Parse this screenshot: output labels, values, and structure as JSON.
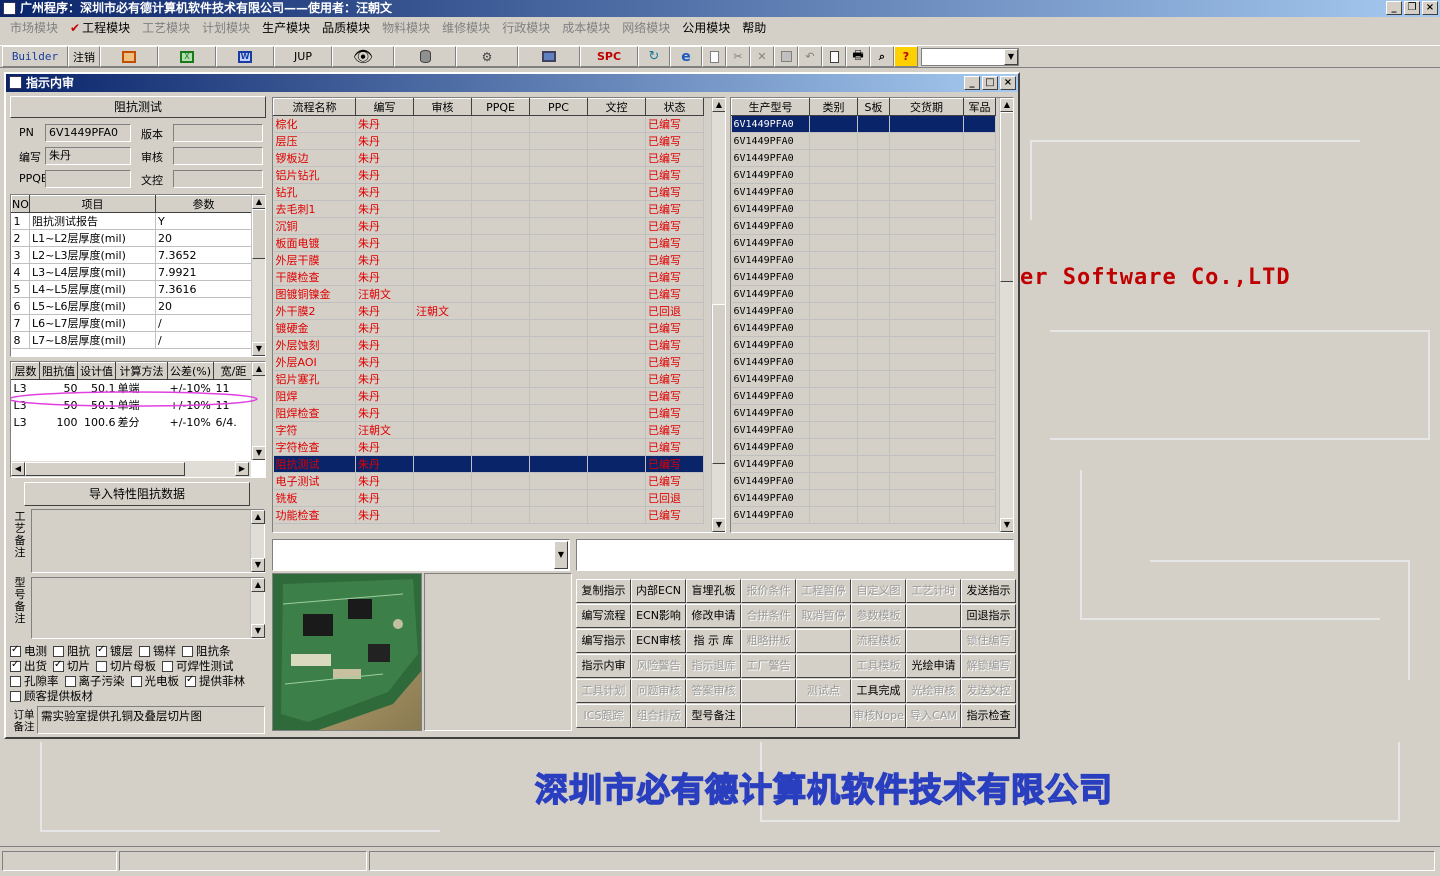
{
  "app": {
    "title": "广州程序：深圳市必有德计算机软件技术有限公司——使用者：汪朝文"
  },
  "menu": [
    {
      "label": "市场模块",
      "active": false
    },
    {
      "label": "工程模块",
      "active": true
    },
    {
      "label": "工艺模块",
      "active": false
    },
    {
      "label": "计划模块",
      "active": false
    },
    {
      "label": "生产模块",
      "active": true
    },
    {
      "label": "品质模块",
      "active": true
    },
    {
      "label": "物料模块",
      "active": false
    },
    {
      "label": "维修模块",
      "active": false
    },
    {
      "label": "行政模块",
      "active": false
    },
    {
      "label": "成本模块",
      "active": false
    },
    {
      "label": "网络模块",
      "active": false
    },
    {
      "label": "公用模块",
      "active": true
    },
    {
      "label": "帮助",
      "active": true
    }
  ],
  "toolbar": {
    "builder": "Builder",
    "logout": "注销",
    "jup": "JUP",
    "spc": "SPC",
    "question": "?"
  },
  "background": {
    "en_text": "er Software Co.,LTD",
    "cn_text": "深圳市必有德计算机软件技术有限公司"
  },
  "child": {
    "title": "指示内审"
  },
  "left": {
    "section_title": "阻抗测试",
    "pn_label": "PN",
    "pn_value": "6V1449PFA0",
    "version_label": "版本",
    "version_value": "",
    "author_label": "编写",
    "author_value": "朱丹",
    "review_label": "审核",
    "review_value": "",
    "ppqe_label": "PPQE",
    "ppqe_value": "",
    "doc_label": "文控",
    "doc_value": "",
    "params_headers": [
      "NO",
      "项目",
      "参数"
    ],
    "params": [
      [
        "1",
        "阻抗测试报告",
        "Y"
      ],
      [
        "2",
        "L1~L2层厚度(mil)",
        "20"
      ],
      [
        "3",
        "L2~L3层厚度(mil)",
        "7.3652"
      ],
      [
        "4",
        "L3~L4层厚度(mil)",
        "7.9921"
      ],
      [
        "5",
        "L4~L5层厚度(mil)",
        "7.3616"
      ],
      [
        "6",
        "L5~L6层厚度(mil)",
        "20"
      ],
      [
        "7",
        "L6~L7层厚度(mil)",
        "/"
      ],
      [
        "8",
        "L7~L8层厚度(mil)",
        "/"
      ]
    ],
    "imp_headers": [
      "层数",
      "阻抗值",
      "设计值",
      "计算方法",
      "公差(%)",
      "宽/距"
    ],
    "imp_rows": [
      [
        "L3",
        "50",
        "50.1",
        "单端",
        "+/-10%",
        "11"
      ],
      [
        "L3",
        "50",
        "50.1",
        "单端",
        "+/-10%",
        "11"
      ],
      [
        "L3",
        "100",
        "100.6",
        "差分",
        "+/-10%",
        "6/4."
      ]
    ],
    "import_btn": "导入特性阻抗数据",
    "process_note_label": "工艺备注",
    "model_note_label": "型号备注",
    "checkboxes": [
      [
        {
          "label": "电测",
          "on": true
        },
        {
          "label": "阻抗",
          "on": false
        },
        {
          "label": "镀层",
          "on": true
        },
        {
          "label": "锡样",
          "on": false
        },
        {
          "label": "阻抗条",
          "on": false
        }
      ],
      [
        {
          "label": "出货",
          "on": true
        },
        {
          "label": "切片",
          "on": true
        },
        {
          "label": "切片母板",
          "on": false
        },
        {
          "label": "可焊性测试",
          "on": false
        }
      ],
      [
        {
          "label": "孔隙率",
          "on": false
        },
        {
          "label": "离子污染",
          "on": false
        },
        {
          "label": "光电板",
          "on": false
        },
        {
          "label": "提供菲林",
          "on": true
        }
      ],
      [
        {
          "label": "顾客提供板材",
          "on": false
        }
      ]
    ],
    "order_note_label": "订单备注",
    "order_note_value": "需实验室提供孔铜及叠层切片图"
  },
  "process": {
    "headers": [
      "流程名称",
      "编写",
      "审核",
      "PPQE",
      "PPC",
      "文控",
      "状态"
    ],
    "rows": [
      [
        "棕化",
        "朱丹",
        "",
        "",
        "",
        "",
        "已编写"
      ],
      [
        "层压",
        "朱丹",
        "",
        "",
        "",
        "",
        "已编写"
      ],
      [
        "锣板边",
        "朱丹",
        "",
        "",
        "",
        "",
        "已编写"
      ],
      [
        "铝片钻孔",
        "朱丹",
        "",
        "",
        "",
        "",
        "已编写"
      ],
      [
        "钻孔",
        "朱丹",
        "",
        "",
        "",
        "",
        "已编写"
      ],
      [
        "去毛刺1",
        "朱丹",
        "",
        "",
        "",
        "",
        "已编写"
      ],
      [
        "沉铜",
        "朱丹",
        "",
        "",
        "",
        "",
        "已编写"
      ],
      [
        "板面电镀",
        "朱丹",
        "",
        "",
        "",
        "",
        "已编写"
      ],
      [
        "外层干膜",
        "朱丹",
        "",
        "",
        "",
        "",
        "已编写"
      ],
      [
        "干膜检查",
        "朱丹",
        "",
        "",
        "",
        "",
        "已编写"
      ],
      [
        "图镀铜镍金",
        "汪朝文",
        "",
        "",
        "",
        "",
        "已编写"
      ],
      [
        "外干膜2",
        "朱丹",
        "汪朝文",
        "",
        "",
        "",
        "已回退"
      ],
      [
        "镀硬金",
        "朱丹",
        "",
        "",
        "",
        "",
        "已编写"
      ],
      [
        "外层蚀刻",
        "朱丹",
        "",
        "",
        "",
        "",
        "已编写"
      ],
      [
        "外层AOI",
        "朱丹",
        "",
        "",
        "",
        "",
        "已编写"
      ],
      [
        "铝片塞孔",
        "朱丹",
        "",
        "",
        "",
        "",
        "已编写"
      ],
      [
        "阻焊",
        "朱丹",
        "",
        "",
        "",
        "",
        "已编写"
      ],
      [
        "阻焊检查",
        "朱丹",
        "",
        "",
        "",
        "",
        "已编写"
      ],
      [
        "字符",
        "汪朝文",
        "",
        "",
        "",
        "",
        "已编写"
      ],
      [
        "字符检查",
        "朱丹",
        "",
        "",
        "",
        "",
        "已编写"
      ],
      [
        "阻抗测试",
        "朱丹",
        "",
        "",
        "",
        "",
        "已编写"
      ],
      [
        "电子测试",
        "朱丹",
        "",
        "",
        "",
        "",
        "已编写"
      ],
      [
        "铣板",
        "朱丹",
        "",
        "",
        "",
        "",
        "已回退"
      ],
      [
        "功能检查",
        "朱丹",
        "",
        "",
        "",
        "",
        "已编写"
      ]
    ]
  },
  "models": {
    "headers": [
      "生产型号",
      "类别",
      "S板",
      "交货期",
      "军品"
    ],
    "rows": [
      "6V1449PFA0",
      "6V1449PFA0",
      "6V1449PFA0",
      "6V1449PFA0",
      "6V1449PFA0",
      "6V1449PFA0",
      "6V1449PFA0",
      "6V1449PFA0",
      "6V1449PFA0",
      "6V1449PFA0",
      "6V1449PFA0",
      "6V1449PFA0",
      "6V1449PFA0",
      "6V1449PFA0",
      "6V1449PFA0",
      "6V1449PFA0",
      "6V1449PFA0",
      "6V1449PFA0",
      "6V1449PFA0",
      "6V1449PFA0",
      "6V1449PFA0",
      "6V1449PFA0",
      "6V1449PFA0",
      "6V1449PFA0"
    ]
  },
  "actions": [
    [
      {
        "label": "复制指示",
        "on": true
      },
      {
        "label": "内部ECN",
        "on": true
      },
      {
        "label": "盲埋孔板",
        "on": true
      },
      {
        "label": "报价条件",
        "on": false
      },
      {
        "label": "工程暂停",
        "on": false
      },
      {
        "label": "自定义图",
        "on": false
      },
      {
        "label": "工艺计时",
        "on": false
      },
      {
        "label": "发送指示",
        "on": true
      }
    ],
    [
      {
        "label": "编写流程",
        "on": true
      },
      {
        "label": "ECN影响",
        "on": true
      },
      {
        "label": "修改申请",
        "on": true
      },
      {
        "label": "合拼条件",
        "on": false
      },
      {
        "label": "取消暂停",
        "on": false
      },
      {
        "label": "参数模板",
        "on": false
      },
      {
        "label": "",
        "on": false
      },
      {
        "label": "回退指示",
        "on": true
      }
    ],
    [
      {
        "label": "编写指示",
        "on": true
      },
      {
        "label": "ECN审核",
        "on": true
      },
      {
        "label": "指 示 库",
        "on": true
      },
      {
        "label": "粗略拼板",
        "on": false
      },
      {
        "label": "",
        "on": false
      },
      {
        "label": "流程模板",
        "on": false
      },
      {
        "label": "",
        "on": false
      },
      {
        "label": "锁住编写",
        "on": false
      }
    ],
    [
      {
        "label": "指示内审",
        "on": true
      },
      {
        "label": "风险警告",
        "on": false
      },
      {
        "label": "指示退库",
        "on": false
      },
      {
        "label": "工厂警告",
        "on": false
      },
      {
        "label": "",
        "on": false
      },
      {
        "label": "工具模板",
        "on": false
      },
      {
        "label": "光绘申请",
        "on": true
      },
      {
        "label": "解锁编写",
        "on": false
      }
    ],
    [
      {
        "label": "工具计划",
        "on": false
      },
      {
        "label": "问题审核",
        "on": false
      },
      {
        "label": "答案审核",
        "on": false
      },
      {
        "label": "",
        "on": false
      },
      {
        "label": "测试点",
        "on": false
      },
      {
        "label": "工具完成",
        "on": true
      },
      {
        "label": "光绘审核",
        "on": false
      },
      {
        "label": "发送文控",
        "on": false
      }
    ],
    [
      {
        "label": "ICS跟踪",
        "on": false
      },
      {
        "label": "组合排版",
        "on": false
      },
      {
        "label": "型号备注",
        "on": true
      },
      {
        "label": "",
        "on": false
      },
      {
        "label": "",
        "on": false
      },
      {
        "label": "审核Nope",
        "on": false
      },
      {
        "label": "导入CAM",
        "on": false
      },
      {
        "label": "指示检查",
        "on": true
      }
    ]
  ]
}
